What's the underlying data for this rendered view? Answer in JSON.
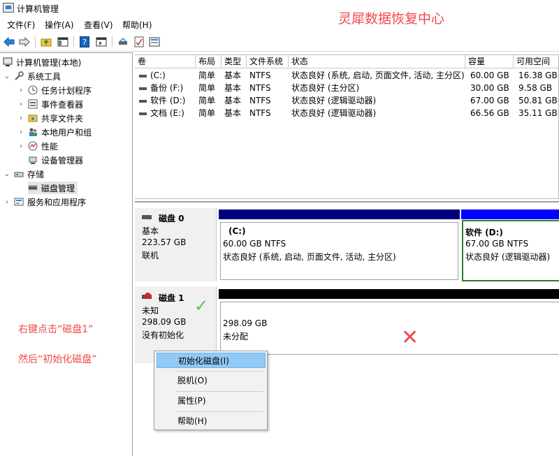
{
  "window": {
    "title": "计算机管理"
  },
  "brand": "灵犀数据恢复中心",
  "menu": [
    "文件(F)",
    "操作(A)",
    "查看(V)",
    "帮助(H)"
  ],
  "toolbar": {
    "icons": [
      "back-arrow-icon",
      "forward-arrow-icon",
      "up-folder-icon",
      "show-hide-tree-icon",
      "help-icon",
      "action-pane-icon",
      "connect-icon",
      "properties-icon",
      "rescan-icon"
    ]
  },
  "tree": {
    "root": "计算机管理(本地)",
    "system_tools": "系统工具",
    "task_scheduler": "任务计划程序",
    "event_viewer": "事件查看器",
    "shared_folders": "共享文件夹",
    "local_users": "本地用户和组",
    "performance": "性能",
    "device_manager": "设备管理器",
    "storage": "存储",
    "disk_management": "磁盘管理",
    "services_apps": "服务和应用程序"
  },
  "instructions": {
    "line1": "右键点击“磁盘1”",
    "line2": "然后“初始化磁盘”"
  },
  "volume_table": {
    "headers": [
      "卷",
      "布局",
      "类型",
      "文件系统",
      "状态",
      "容量",
      "可用空间"
    ],
    "rows": [
      [
        "(C:)",
        "简单",
        "基本",
        "NTFS",
        "状态良好 (系统, 启动, 页面文件, 活动, 主分区)",
        "60.00 GB",
        "16.38 GB"
      ],
      [
        "备份 (F:)",
        "简单",
        "基本",
        "NTFS",
        "状态良好 (主分区)",
        "30.00 GB",
        "9.58 GB"
      ],
      [
        "软件 (D:)",
        "简单",
        "基本",
        "NTFS",
        "状态良好 (逻辑驱动器)",
        "67.00 GB",
        "50.81 GB"
      ],
      [
        "文档 (E:)",
        "简单",
        "基本",
        "NTFS",
        "状态良好 (逻辑驱动器)",
        "66.56 GB",
        "35.11 GB"
      ]
    ]
  },
  "disk0": {
    "name": "磁盘 0",
    "type": "基本",
    "size": "223.57 GB",
    "status": "联机",
    "partitions": [
      {
        "label": "(C:)",
        "size_fs": "60.00 GB NTFS",
        "status": "状态良好 (系统, 启动, 页面文件, 活动, 主分区)"
      },
      {
        "label": "软件  (D:)",
        "size_fs": "67.00 GB NTFS",
        "status": "状态良好 (逻辑驱动器)"
      }
    ],
    "colors": {
      "primary_bar": "#00007b",
      "logical_bar": "#0000ff",
      "selected_frame": "#2e7d32"
    }
  },
  "disk1": {
    "name": "磁盘 1",
    "type": "未知",
    "size": "298.09 GB",
    "status": "没有初始化",
    "unallocated": {
      "size": "298.09 GB",
      "label": "未分配"
    },
    "colors": {
      "bar": "#000000"
    }
  },
  "marks": {
    "check": "✓",
    "cross": "✕"
  },
  "context_menu": {
    "items": [
      "初始化磁盘(I)",
      "脱机(O)",
      "属性(P)",
      "帮助(H)"
    ],
    "highlighted": "初始化磁盘(I)"
  },
  "accent_colors": {
    "annotation_red": "#f04848",
    "check_green": "#57c257",
    "menu_highlight": "#91c9f7"
  }
}
